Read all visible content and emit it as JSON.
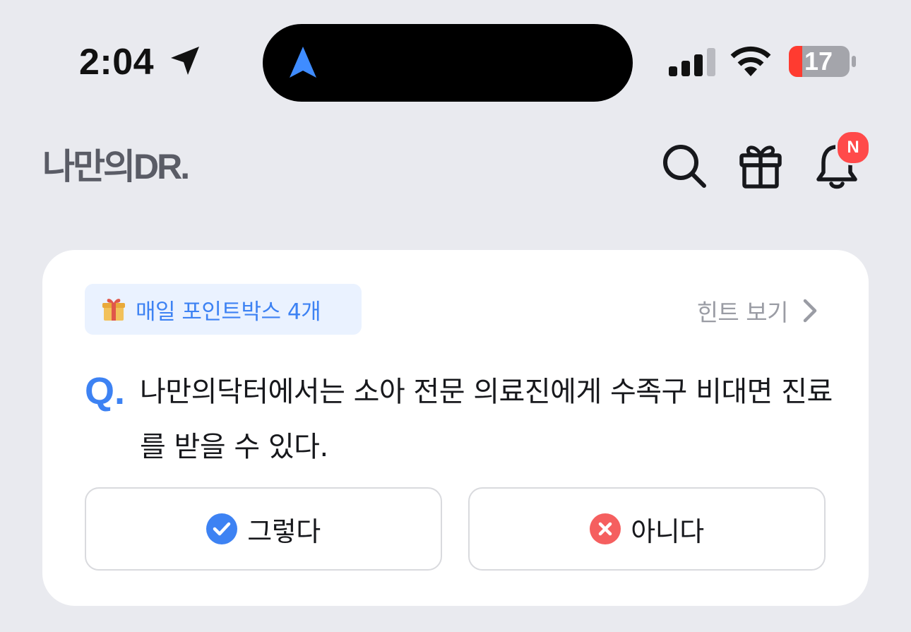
{
  "status_bar": {
    "time": "2:04",
    "battery_level": "17",
    "battery_low_color": "#ff3b30",
    "icons": [
      "location-arrow-icon",
      "navigation-arrow-icon",
      "cellular-signal-icon",
      "wifi-icon",
      "battery-icon"
    ]
  },
  "header": {
    "logo_text": "나만의DR.",
    "icons": [
      "search-icon",
      "gift-icon",
      "bell-icon"
    ],
    "notification_badge": "N"
  },
  "quiz_card": {
    "reward_pill": "매일 포인트박스 4개",
    "hint_link": "힌트 보기",
    "question_prefix": "Q.",
    "question_text": "나만의닥터에서는 소아 전문 의료진에게 수족구 비대면 진료를 받을 수 있다.",
    "answers": {
      "yes": "그렇다",
      "no": "아니다"
    }
  },
  "colors": {
    "background": "#e9eaef",
    "accent_blue": "#3d82f3",
    "badge_red": "#ff4a4a",
    "no_red": "#f55f5f"
  }
}
